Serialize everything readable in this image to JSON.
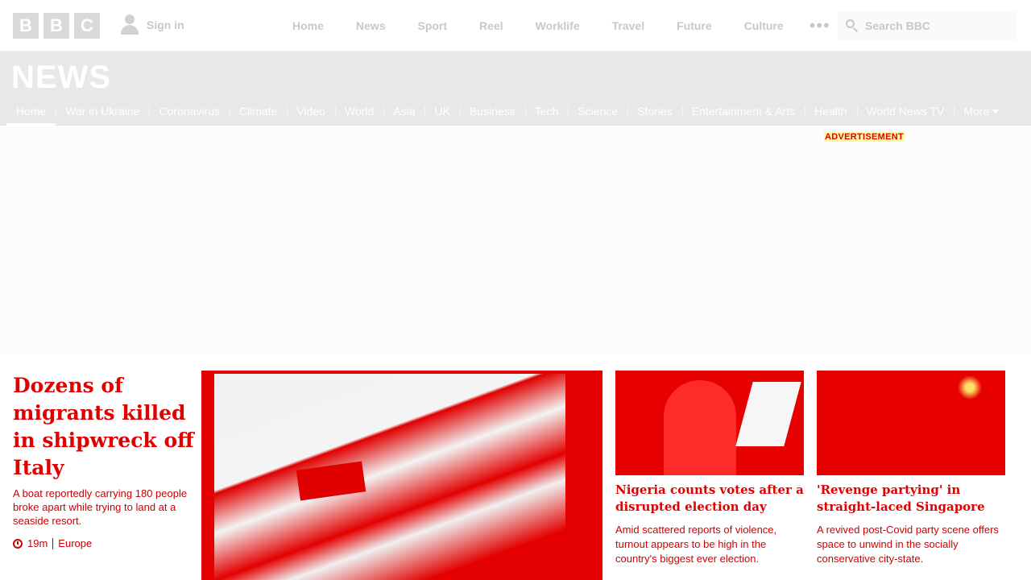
{
  "header": {
    "logo_letters": [
      "B",
      "B",
      "C"
    ],
    "signin_label": "Sign in",
    "nav": [
      "Home",
      "News",
      "Sport",
      "Reel",
      "Worklife",
      "Travel",
      "Future",
      "Culture"
    ],
    "more_dots": "•••",
    "search_placeholder": "Search BBC"
  },
  "section": {
    "brand": "NEWS",
    "subnav": [
      "Home",
      "War in Ukraine",
      "Coronavirus",
      "Climate",
      "Video",
      "World",
      "Asia",
      "UK",
      "Business",
      "Tech",
      "Science",
      "Stories",
      "Entertainment & Arts",
      "Health",
      "World News TV",
      "More"
    ],
    "active_index": 0
  },
  "advertisement": {
    "label": "ADVERTISEMENT"
  },
  "lead_story": {
    "title": "Dozens of migrants killed in shipwreck off Italy",
    "summary": "A boat reportedly carrying 180 people broke apart while trying to land at a seaside resort.",
    "time": "19m",
    "tag": "Europe"
  },
  "stories": [
    {
      "title": "Nigeria counts votes after a disrupted election day",
      "summary": "Amid scattered reports of violence, turnout appears to be high in the country's biggest ever election."
    },
    {
      "title": "'Revenge partying' in straight-laced Singapore",
      "summary": "A revived post-Covid party scene offers space to unwind in the socially conservative city-state."
    }
  ],
  "colors": {
    "accent": "#e00000",
    "highlight": "#fff9a6",
    "band": "#e8e8e8"
  }
}
